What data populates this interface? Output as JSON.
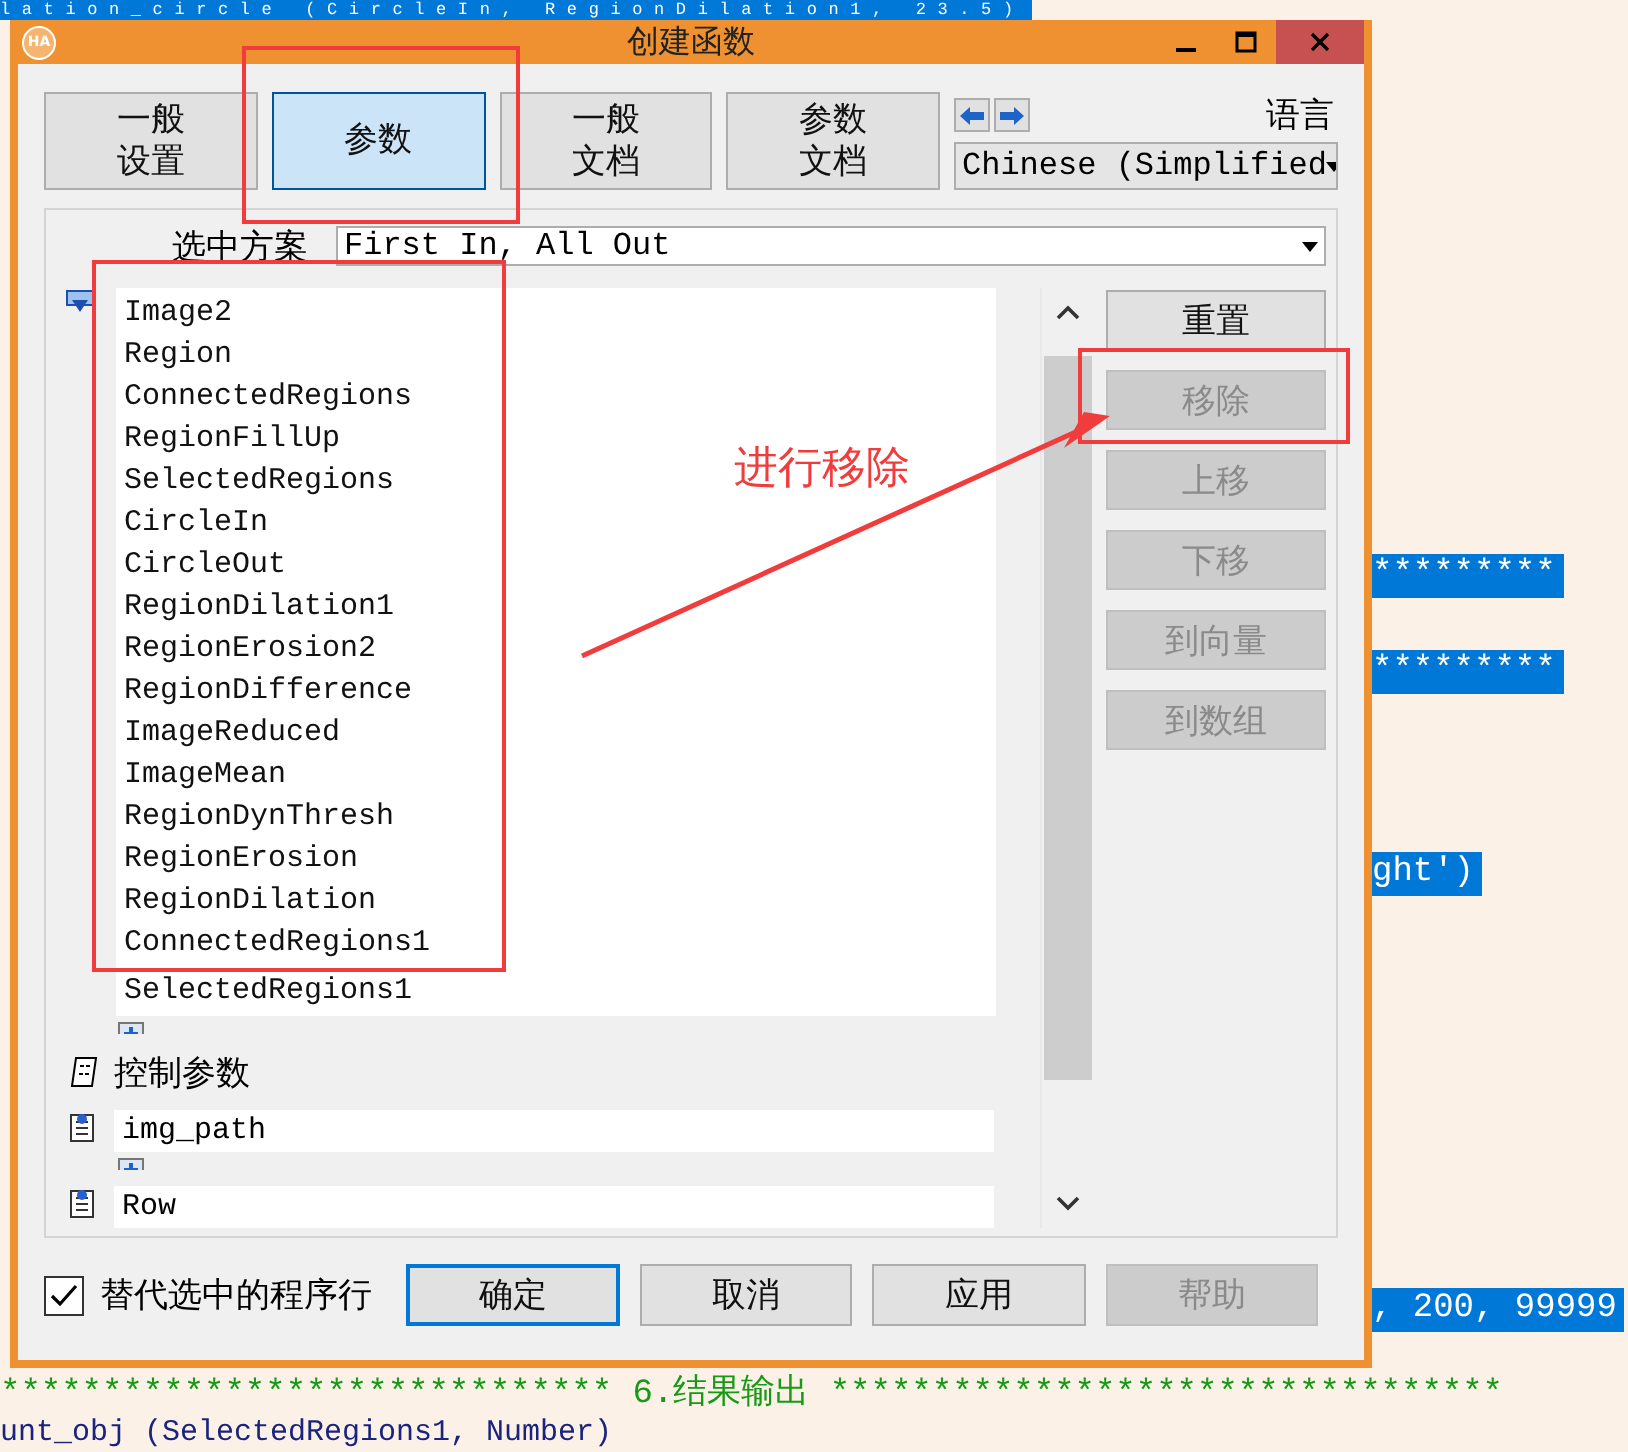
{
  "editor": {
    "lines": [
      {
        "text": "lation_circle (CircleIn, RegionDilation1, 23.5)",
        "kind": "selected"
      },
      {
        "text": "*********",
        "kind": "selected"
      },
      {
        "text": "*********",
        "kind": "selected"
      },
      {
        "text": "ght')",
        "kind": "selected"
      },
      {
        "text": ", 200, 99999",
        "kind": "selected"
      },
      {
        "text": "****************************** 6.结果输出 *********************************",
        "kind": "comment"
      },
      {
        "text": "unt_obj (SelectedRegions1, Number)",
        "kind": "code"
      }
    ]
  },
  "dialog": {
    "logo": "HA",
    "title": "创建函数",
    "tabs": [
      {
        "label": "一般设置",
        "selected": false
      },
      {
        "label": "参数",
        "selected": true
      },
      {
        "label": "一般文档",
        "selected": false
      },
      {
        "label": "参数文档",
        "selected": false
      }
    ],
    "language": {
      "label": "语言",
      "value": "Chinese (Simplified"
    },
    "scheme": {
      "label": "选中方案",
      "value": "First In, All Out"
    },
    "iconic_params": [
      "Image2",
      "Region",
      "ConnectedRegions",
      "RegionFillUp",
      "SelectedRegions",
      "CircleIn",
      "CircleOut",
      "RegionDilation1",
      "RegionErosion2",
      "RegionDifference",
      "ImageReduced",
      "ImageMean",
      "RegionDynThresh",
      "RegionErosion",
      "RegionDilation",
      "ConnectedRegions1",
      "SelectedRegions1"
    ],
    "control_section": {
      "label": "控制参数"
    },
    "control_params": [
      "img_path",
      "Row"
    ],
    "side_buttons": [
      {
        "label": "重置",
        "disabled": false
      },
      {
        "label": "移除",
        "disabled": true
      },
      {
        "label": "上移",
        "disabled": true
      },
      {
        "label": "下移",
        "disabled": true
      },
      {
        "label": "到向量",
        "disabled": true
      },
      {
        "label": "到数组",
        "disabled": true
      }
    ],
    "replace_checkbox": {
      "label": "替代选中的程序行",
      "checked": true
    },
    "buttons": [
      {
        "label": "确定",
        "default": true,
        "disabled": false
      },
      {
        "label": "取消",
        "default": false,
        "disabled": false
      },
      {
        "label": "应用",
        "default": false,
        "disabled": false
      },
      {
        "label": "帮助",
        "default": false,
        "disabled": true
      }
    ]
  },
  "annotation": {
    "text": "进行移除"
  }
}
